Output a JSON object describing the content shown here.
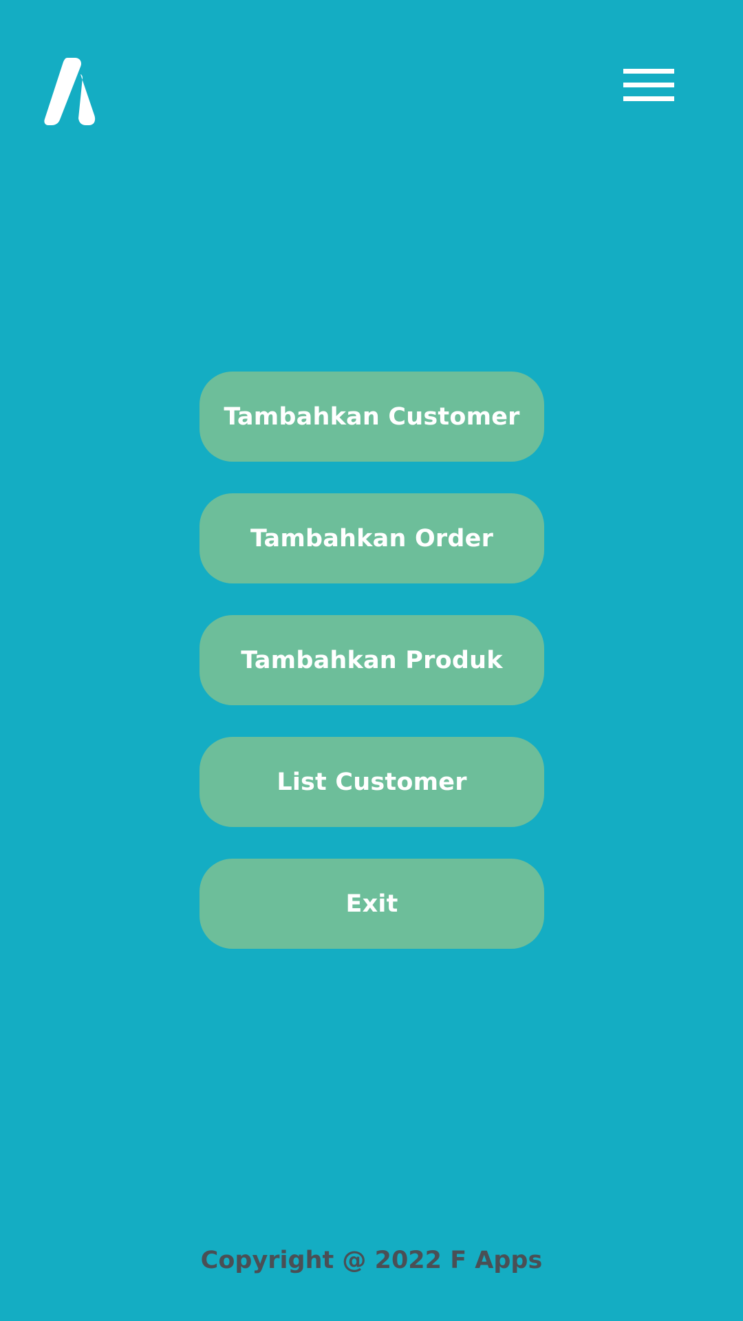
{
  "header": {
    "logo_icon": "brand-logo-icon",
    "menu_icon": "hamburger-menu-icon"
  },
  "menu": {
    "items": [
      {
        "label": "Tambahkan Customer"
      },
      {
        "label": "Tambahkan Order"
      },
      {
        "label": "Tambahkan Produk"
      },
      {
        "label": "List Customer"
      },
      {
        "label": "Exit"
      }
    ]
  },
  "footer": {
    "text": "Copyright @ 2022 F Apps"
  },
  "colors": {
    "background": "#14adc3",
    "button": "#6dbe9a",
    "button_text": "#ffffff",
    "footer_text": "#4a4f55"
  }
}
